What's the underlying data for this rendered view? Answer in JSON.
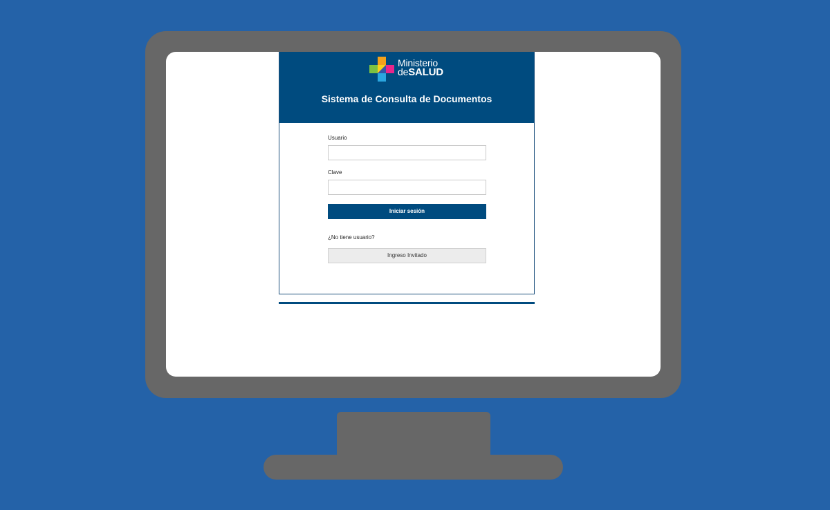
{
  "colors": {
    "background": "#2462a8",
    "monitor": "#676767",
    "header": "#004b7f",
    "login_button": "#004b7f",
    "guest_button": "#ececec"
  },
  "logo": {
    "line1": "Ministerio",
    "line2_prefix": "de",
    "line2_bold": "SALUD",
    "icon": "colorful-cross-icon"
  },
  "header": {
    "title": "Sistema de Consulta de Documentos"
  },
  "form": {
    "username_label": "Usuario",
    "username_value": "",
    "password_label": "Clave",
    "password_value": "",
    "login_button": "Iniciar sesión",
    "no_user_text": "¿No tiene usuario?",
    "guest_button": "Ingreso Invitado"
  }
}
